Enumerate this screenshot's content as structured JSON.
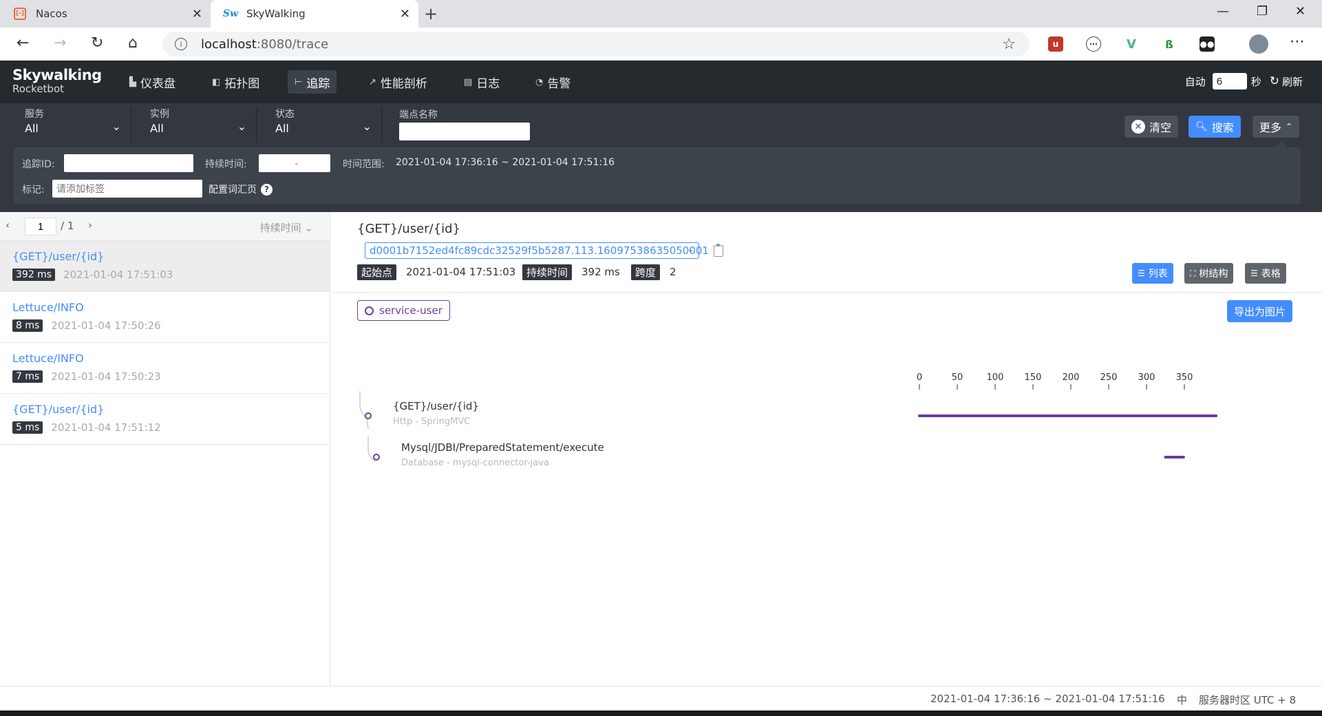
{
  "browser": {
    "tabs": [
      {
        "title": "Nacos",
        "icon": "nacos-logo-icon"
      },
      {
        "title": "SkyWalking",
        "icon": "skywalking-logo-icon"
      }
    ],
    "url_host": "localhost",
    "url_path": ":8080/trace"
  },
  "app": {
    "logo_main": "Skywalking",
    "logo_sub": "Rocketbot",
    "nav": [
      {
        "label": "仪表盘",
        "icon": "dashboard-icon"
      },
      {
        "label": "拓扑图",
        "icon": "topology-icon"
      },
      {
        "label": "追踪",
        "icon": "trace-icon",
        "active": true
      },
      {
        "label": "性能剖析",
        "icon": "profile-icon"
      },
      {
        "label": "日志",
        "icon": "log-icon"
      },
      {
        "label": "告警",
        "icon": "alarm-icon"
      }
    ],
    "auto_label": "自动",
    "auto_value": "6",
    "seconds_label": "秒",
    "refresh_label": "刷新"
  },
  "filters": {
    "service": {
      "label": "服务",
      "value": "All"
    },
    "instance": {
      "label": "实例",
      "value": "All"
    },
    "status": {
      "label": "状态",
      "value": "All"
    },
    "endpoint_label": "端点名称",
    "clear_label": "清空",
    "search_label": "搜索",
    "more_label": "更多",
    "trace_id_label": "追踪ID:",
    "duration_label": "持续时间:",
    "duration_placeholder": "-",
    "time_range_label": "时间范围:",
    "time_range_value": "2021-01-04 17:36:16 ~ 2021-01-04 17:51:16",
    "tag_label": "标记:",
    "tag_placeholder": "请添加标签",
    "vocab_link": "配置词汇页"
  },
  "list": {
    "page_current": "1",
    "page_total": "/ 1",
    "sort_label": "持续时间",
    "items": [
      {
        "name": "{GET}/user/{id}",
        "duration": "392 ms",
        "time": "2021-01-04 17:51:03"
      },
      {
        "name": "Lettuce/INFO",
        "duration": "8 ms",
        "time": "2021-01-04 17:50:26"
      },
      {
        "name": "Lettuce/INFO",
        "duration": "7 ms",
        "time": "2021-01-04 17:50:23"
      },
      {
        "name": "{GET}/user/{id}",
        "duration": "5 ms",
        "time": "2021-01-04 17:51:12"
      }
    ]
  },
  "detail": {
    "title": "{GET}/user/{id}",
    "trace_id": "d0001b7152ed4fc89cdc32529f5b5287.113.16097538635050001",
    "start_label": "起始点",
    "start_value": "2021-01-04 17:51:03",
    "duration_label": "持续时间",
    "duration_value": "392 ms",
    "span_label": "跨度",
    "span_value": "2",
    "view_list": "列表",
    "view_tree": "树结构",
    "view_table": "表格",
    "service_tag": "service-user",
    "export_label": "导出为图片"
  },
  "chart_data": {
    "type": "timeline",
    "axis_ticks": [
      0,
      50,
      100,
      150,
      200,
      250,
      300,
      350
    ],
    "total_ms": 392,
    "color": "#6a3d9a",
    "spans": [
      {
        "name": "{GET}/user/{id}",
        "type": "Http - SpringMVC",
        "depth": 0,
        "start": 0,
        "end": 392
      },
      {
        "name": "Mysql/JDBI/PreparedStatement/execute",
        "type": "Database - mysql-connector-java",
        "depth": 1,
        "start": 325,
        "end": 349
      }
    ]
  },
  "footer": {
    "time_range": "2021-01-04 17:36:16 ~ 2021-01-04 17:51:16",
    "lang": "中",
    "timezone": "服务器时区 UTC + 8"
  }
}
